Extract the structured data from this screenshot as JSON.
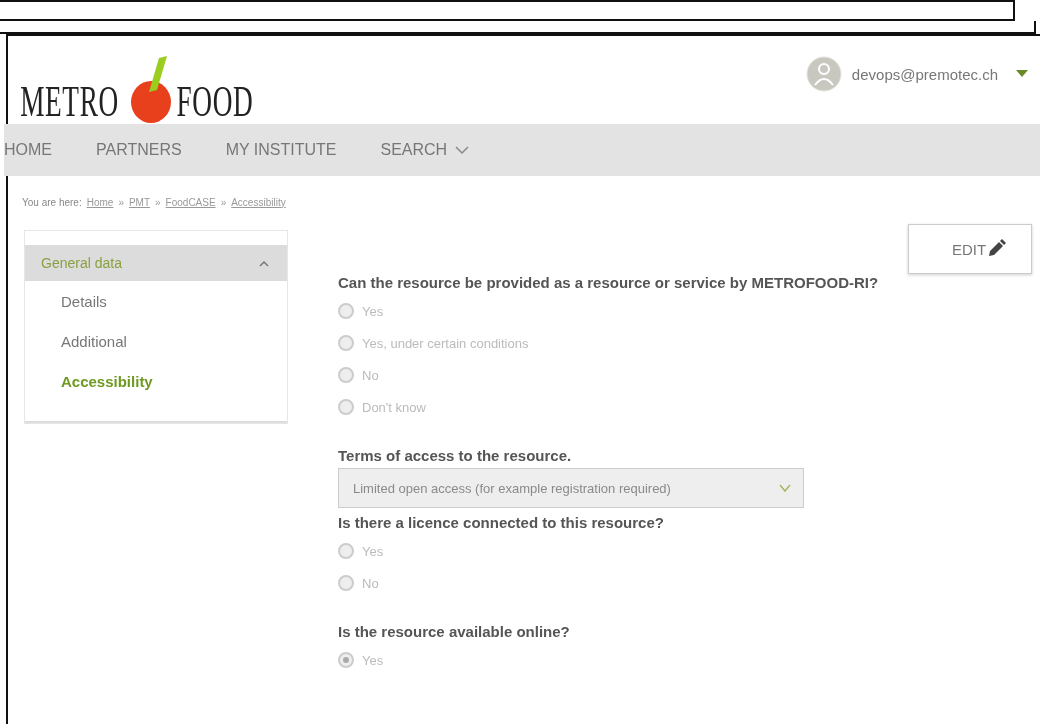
{
  "header": {
    "logo": {
      "left": "METRO",
      "right": "FOOD"
    },
    "user": "devops@premotec.ch"
  },
  "nav": [
    {
      "label": "HOME",
      "dropdown": false
    },
    {
      "label": "PARTNERS",
      "dropdown": false
    },
    {
      "label": "MY INSTITUTE",
      "dropdown": false
    },
    {
      "label": "SEARCH",
      "dropdown": true
    }
  ],
  "breadcrumb": {
    "prefix": "You are here:",
    "separator": "»",
    "items": [
      "Home",
      "PMT",
      "FoodCASE",
      "Accessibility"
    ]
  },
  "sidebar": {
    "group": {
      "label": "General data",
      "expanded": true
    },
    "items": [
      {
        "label": "Details",
        "selected": false
      },
      {
        "label": "Additional",
        "selected": false
      },
      {
        "label": "Accessibility",
        "selected": true
      }
    ]
  },
  "edit_button": "EDIT",
  "questions": [
    {
      "kind": "radio",
      "label": "Can the resource be provided as a resource or service by METROFOOD-RI?",
      "options": [
        {
          "label": "Yes",
          "selected": false
        },
        {
          "label": "Yes, under certain conditions",
          "selected": false
        },
        {
          "label": "No",
          "selected": false
        },
        {
          "label": "Don't know",
          "selected": false
        }
      ]
    },
    {
      "kind": "select",
      "label": "Terms of access to the resource.",
      "value": "Limited open access (for example registration required)"
    },
    {
      "kind": "radio",
      "label": "Is there a licence connected to this resource?",
      "options": [
        {
          "label": "Yes",
          "selected": false
        },
        {
          "label": "No",
          "selected": false
        }
      ]
    },
    {
      "kind": "radio",
      "label": "Is the resource available online?",
      "options": [
        {
          "label": "Yes",
          "selected": true
        }
      ]
    }
  ]
}
